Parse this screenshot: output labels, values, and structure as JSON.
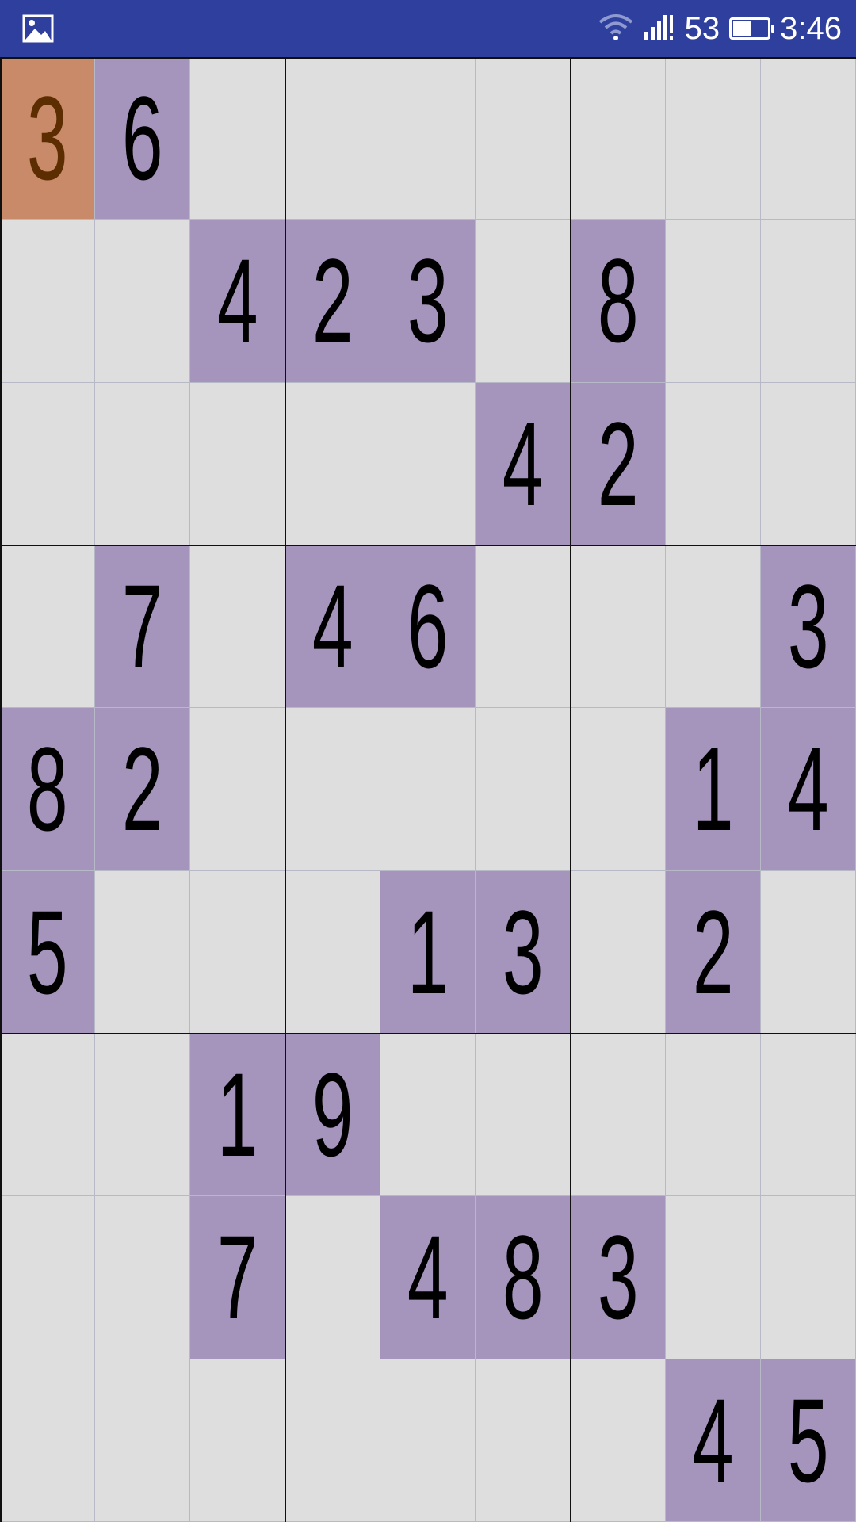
{
  "status_bar": {
    "signal_value": "53",
    "time": "3:46",
    "battery_level": 0.55,
    "icons": [
      "image-icon",
      "wifi-icon",
      "signal-icon",
      "battery-icon"
    ],
    "background_color": "#2e3f9e"
  },
  "board": {
    "colors": {
      "given": "#a594bb",
      "empty": "#dedede",
      "selected": "#c98a6a",
      "selected_text": "#5b2d00"
    },
    "selected_cell": [
      0,
      0
    ],
    "rows": [
      [
        "3",
        "6",
        "",
        "",
        "",
        "",
        "",
        "",
        ""
      ],
      [
        "",
        "",
        "4",
        "2",
        "3",
        "",
        "8",
        "",
        ""
      ],
      [
        "",
        "",
        "",
        "",
        "",
        "4",
        "2",
        "",
        ""
      ],
      [
        "",
        "7",
        "",
        "4",
        "6",
        "",
        "",
        "",
        "3"
      ],
      [
        "8",
        "2",
        "",
        "",
        "",
        "",
        "",
        "1",
        "4"
      ],
      [
        "5",
        "",
        "",
        "",
        "1",
        "3",
        "",
        "2",
        ""
      ],
      [
        "",
        "",
        "1",
        "9",
        "",
        "",
        "",
        "",
        ""
      ],
      [
        "",
        "",
        "7",
        "",
        "4",
        "8",
        "3",
        "",
        ""
      ],
      [
        "",
        "",
        "",
        "",
        "",
        "",
        "",
        "4",
        "5"
      ]
    ]
  }
}
